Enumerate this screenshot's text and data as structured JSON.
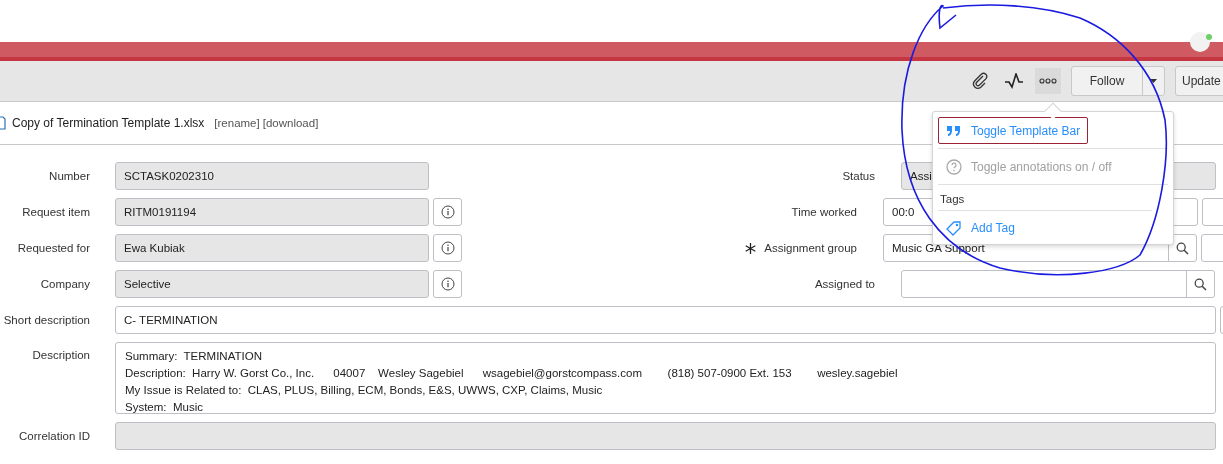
{
  "toolbar": {
    "buttons": [
      {
        "kind": "split",
        "label": "Follow"
      },
      {
        "kind": "plain",
        "label": "Update"
      }
    ]
  },
  "attachment": {
    "file_name": "Copy of Termination Template 1.xlsx",
    "links": [
      "[rename]",
      "[download]"
    ]
  },
  "form": {
    "rows": [
      {
        "left": {
          "label": "Number",
          "value": "SCTASK0202310",
          "kind": "readonly"
        },
        "right": {
          "label": "Status",
          "value": "Assi",
          "kind": "readonly"
        }
      },
      {
        "left": {
          "label": "Request item",
          "value": "RITM0191194",
          "kind": "reference"
        },
        "right": {
          "label": "Time worked",
          "value": "00:0",
          "kind": "input",
          "side_button": true
        }
      },
      {
        "left": {
          "label": "Requested for",
          "value": "Ewa Kubiak",
          "kind": "reference"
        },
        "right": {
          "label": "Assignment group",
          "value": "Music GA Support",
          "kind": "lookup",
          "mandatory": true,
          "side_button": true
        }
      },
      {
        "left": {
          "label": "Company",
          "value": "Selective",
          "kind": "reference"
        },
        "right": {
          "label": "Assigned to",
          "kind": "lookup"
        }
      }
    ],
    "full": [
      {
        "label": "Short description",
        "kind": "input",
        "value": "C- TERMINATION",
        "side_button": true
      },
      {
        "label": "Description",
        "kind": "textarea",
        "lines": [
          "Summary:  TERMINATION",
          "Description:  Harry W. Gorst Co., Inc.      04007    Wesley Sagebiel      wsagebiel@gorstcompass.com        (818) 507-0900 Ext. 153        wesley.sagebiel",
          "My Issue is Related to:  CLAS, PLUS, Billing, ECM, Bonds, E&S, UWWS, CXP, Claims, Music",
          "System:  Music"
        ]
      },
      {
        "label": "Correlation ID",
        "kind": "readonly"
      }
    ]
  },
  "menu": {
    "items": [
      {
        "label": "Toggle Template Bar",
        "focused": true,
        "disabled": false
      },
      {
        "label": "Toggle annotations on / off",
        "focused": false,
        "disabled": true
      }
    ],
    "tags": {
      "heading": "Tags",
      "items": [
        {
          "label": "Add Tag"
        }
      ]
    }
  }
}
